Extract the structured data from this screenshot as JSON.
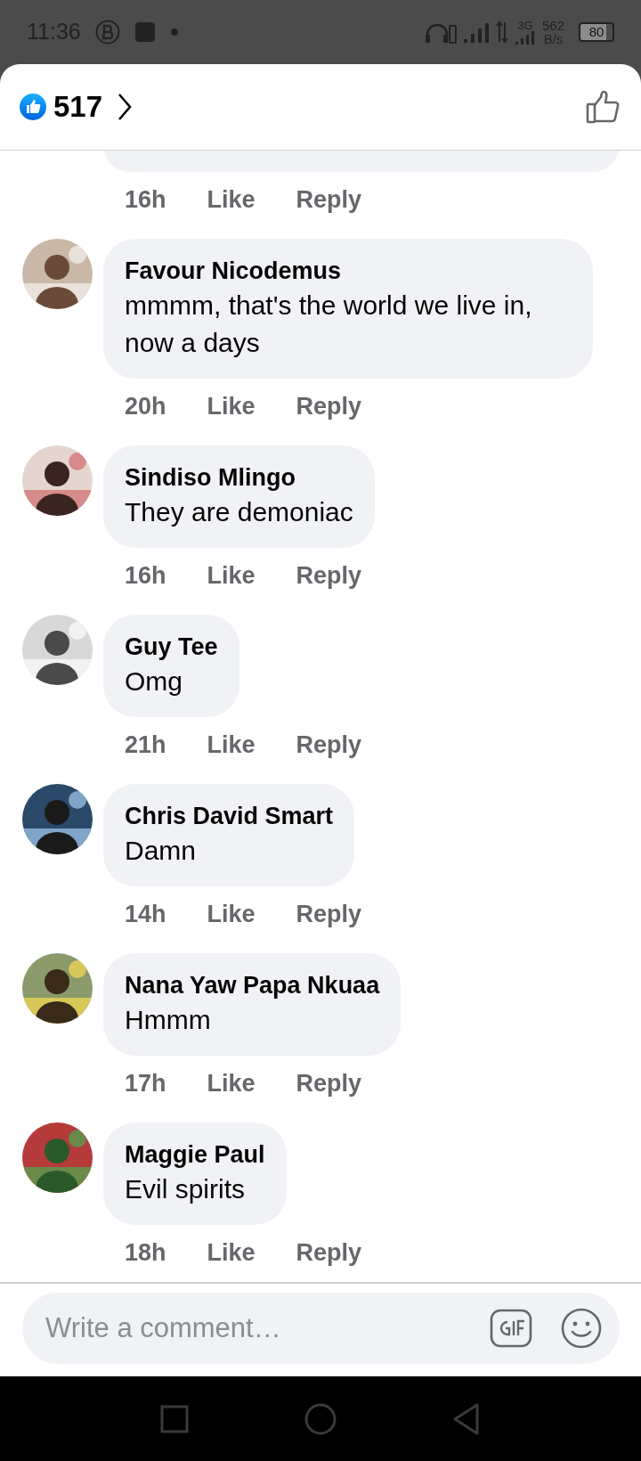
{
  "status_bar": {
    "time": "11:36",
    "network": "3G",
    "speed": "562",
    "speed_unit": "B/s",
    "battery": "80"
  },
  "header": {
    "count": "517"
  },
  "comments": [
    {
      "kind": "partial",
      "time": "16h",
      "like": "Like",
      "reply": "Reply"
    },
    {
      "kind": "full",
      "author": "Favour Nicodemus",
      "text": "mmmm, that's the world we live in, now a days",
      "time": "20h",
      "like": "Like",
      "reply": "Reply"
    },
    {
      "kind": "full",
      "author": "Sindiso Mlingo",
      "text": "They are demoniac",
      "time": "16h",
      "like": "Like",
      "reply": "Reply"
    },
    {
      "kind": "full",
      "author": "Guy Tee",
      "text": "Omg",
      "time": "21h",
      "like": "Like",
      "reply": "Reply"
    },
    {
      "kind": "full",
      "author": "Chris David Smart",
      "text": "Damn",
      "time": "14h",
      "like": "Like",
      "reply": "Reply"
    },
    {
      "kind": "full",
      "author": "Nana Yaw Papa Nkuaa",
      "text": "Hmmm",
      "time": "17h",
      "like": "Like",
      "reply": "Reply"
    },
    {
      "kind": "full",
      "author": "Maggie Paul",
      "text": "Evil spirits",
      "time": "18h",
      "like": "Like",
      "reply": "Reply"
    }
  ],
  "composer": {
    "placeholder": "Write a comment…"
  }
}
